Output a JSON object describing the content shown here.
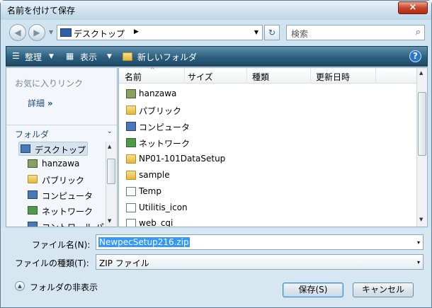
{
  "window": {
    "title": "名前を付けて保存",
    "close_glyph": "×"
  },
  "nav": {
    "back_glyph": "◀",
    "forward_glyph": "▶",
    "history_glyph": "▼",
    "location": "デスクトップ",
    "location_arrow": "▶",
    "location_drop": "▼",
    "refresh_glyph": "↻",
    "search_placeholder": "検索",
    "search_glyph": "⌕"
  },
  "toolbar": {
    "organize": "整理",
    "views": "表示",
    "new_folder": "新しいフォルダ",
    "organize_arrow": "▼",
    "views_arrow": "▼",
    "help": "?",
    "views_glyph": "▦"
  },
  "sidebar": {
    "favorites_label": "お気に入りリンク",
    "details_label": "詳細",
    "details_glyph": "»",
    "folders_label": "フォルダ",
    "folders_chevron": "⌄",
    "tree": [
      {
        "label": "デスクトップ",
        "icon": "pc-icon"
      },
      {
        "label": "hanzawa",
        "icon": "user-icon"
      },
      {
        "label": "パブリック",
        "icon": "folder-icon"
      },
      {
        "label": "コンピュータ",
        "icon": "computer-icon"
      },
      {
        "label": "ネットワーク",
        "icon": "network-icon"
      },
      {
        "label": "コントロール パ",
        "icon": "control-panel-icon"
      }
    ],
    "scroll_up": "▲",
    "scroll_down": "▼"
  },
  "filelist": {
    "columns": [
      "名前",
      "サイズ",
      "種類",
      "更新日時"
    ],
    "sort_glyph": "^",
    "items": [
      {
        "name": "hanzawa",
        "icon": "user-icon"
      },
      {
        "name": "パブリック",
        "icon": "folder-icon"
      },
      {
        "name": "コンピュータ",
        "icon": "computer-icon"
      },
      {
        "name": "ネットワーク",
        "icon": "network-icon"
      },
      {
        "name": "NP01-101DataSetup",
        "icon": "folder-icon"
      },
      {
        "name": "sample",
        "icon": "folder-icon"
      },
      {
        "name": "Temp",
        "icon": "shortcut-icon"
      },
      {
        "name": "Utilitis_icon",
        "icon": "shortcut-icon"
      },
      {
        "name": "web_cgi",
        "icon": "shortcut-icon"
      }
    ],
    "scroll_up": "▲",
    "scroll_down": "▼"
  },
  "form": {
    "filename_label": "ファイル名(N):",
    "filename_value": "NewpecSetup216.zip",
    "filetype_label": "ファイルの種類(T):",
    "filetype_value": "ZIP ファイル",
    "dropdown_glyph": "▾",
    "hide_folders_label": "フォルダの非表示",
    "hide_folders_glyph": "▲",
    "save_label": "保存(S)",
    "cancel_label": "キャンセル"
  }
}
